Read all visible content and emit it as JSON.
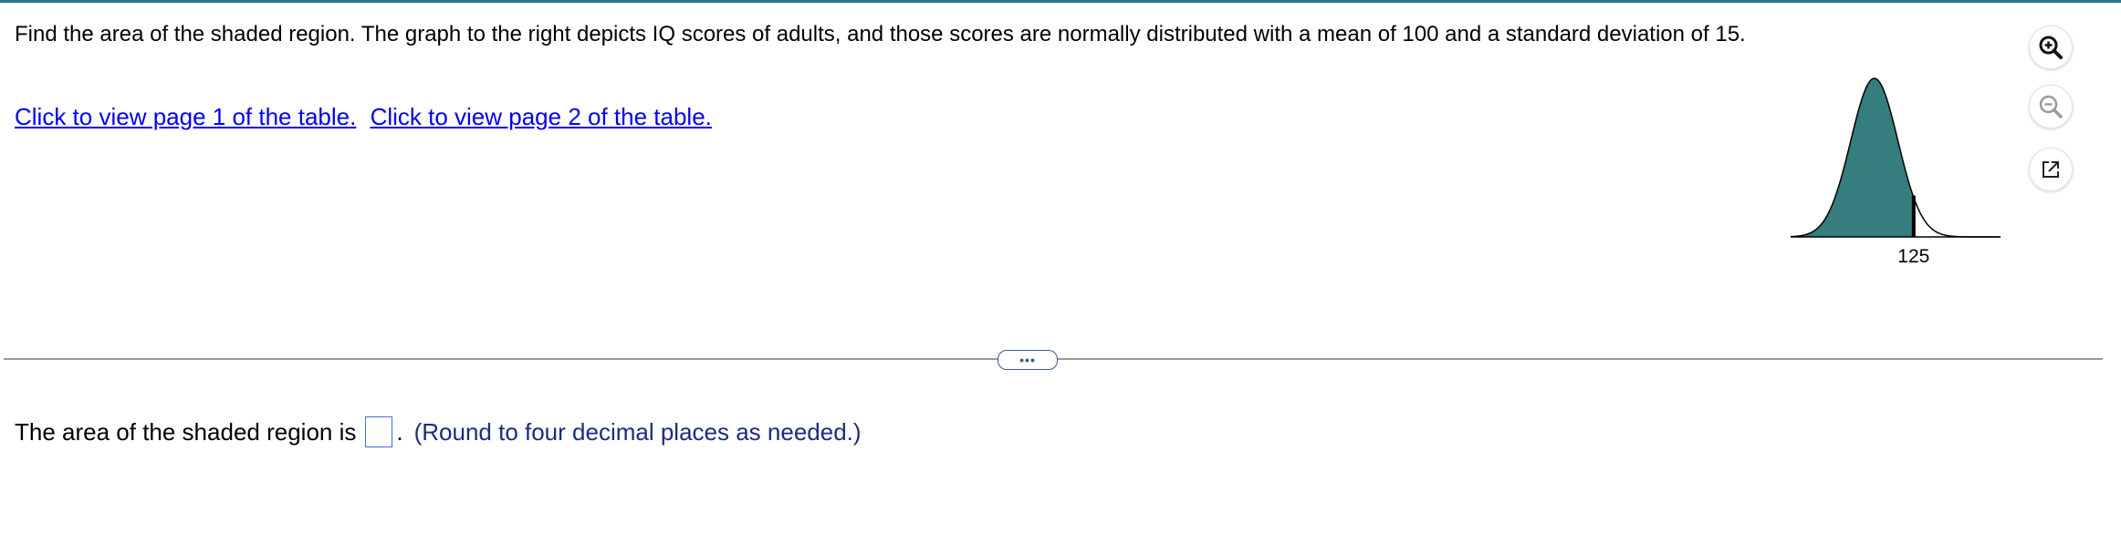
{
  "question": {
    "text": "Find the area of the shaded region. The graph to the right depicts IQ scores of adults, and those scores are normally distributed with a mean of 100 and a standard deviation of 15."
  },
  "links": {
    "page1": "Click to view page 1 of the table.",
    "page2": "Click to view page 2 of the table."
  },
  "figure": {
    "tick_label": "125",
    "fill_color": "#367d7d"
  },
  "tools": {
    "zoom_in_icon": "zoom-in-icon",
    "zoom_out_icon": "zoom-out-icon",
    "popout_icon": "external-link-icon"
  },
  "divider": {
    "more_label": "•••"
  },
  "answer": {
    "prefix": "The area of the shaded region is",
    "input_value": "",
    "suffix": ".",
    "hint": "(Round to four decimal places as needed.)"
  },
  "colors": {
    "link": "#0000ee",
    "hint": "#1d2a80",
    "input_border": "#3d73c9",
    "top_border": "#2f6f8f"
  }
}
